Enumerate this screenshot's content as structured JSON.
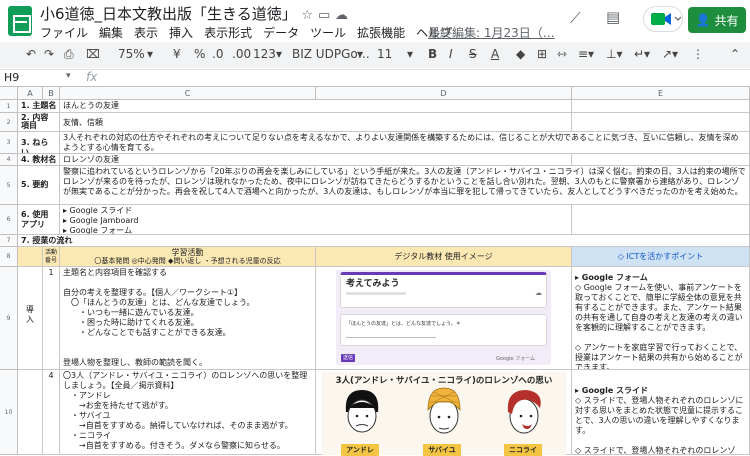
{
  "header": {
    "title": "小6道徳_日本文教出版「生きる道徳」",
    "menu": [
      "ファイル",
      "編集",
      "表示",
      "挿入",
      "表示形式",
      "データ",
      "ツール",
      "拡張機能",
      "ヘルプ"
    ],
    "last_edit": "最終編集: 1月23日（…",
    "share_label": "共有"
  },
  "toolbar": {
    "zoom": "75%",
    "currency": "¥",
    "percent": "%",
    "decimal_dec": ".0",
    "decimal_inc": ".00",
    "format": "123",
    "font": "BIZ UDPGo…",
    "font_size": "11",
    "bold": "B",
    "italic": "I",
    "strike": "S",
    "text_color": "A"
  },
  "formula_bar": {
    "cell_ref": "H9",
    "fx": "fx"
  },
  "columns": [
    "A",
    "B",
    "C",
    "D",
    "E"
  ],
  "rows": {
    "r1": {
      "num": "1",
      "label": "1. 主題名",
      "value": "ほんとうの友達"
    },
    "r2": {
      "num": "2",
      "label": "2. 内容\n項目",
      "value": "友情、信頼"
    },
    "r3": {
      "num": "3",
      "label": "3. ねらい",
      "value": "3人それぞれの対応の仕方やそれぞれの考えについて足りない点を考えるなかで、よりよい友達関係を構築するためには、信じることが大切であることに気づき、互いに信頼し、友情を深めようとする心情を育てる。"
    },
    "r4": {
      "num": "4",
      "label": "4. 教材名",
      "value": "ロレンゾの友達"
    },
    "r5": {
      "num": "5",
      "label": "5. 要約",
      "value": "警察に追われているというロレンゾから「20年ぶりの再会を楽しみにしている」という手紙が来た。3人の友達（アンドレ・サバイユ・ニコライ）は深く悩む。約束の日、3人は約束の場所でロレンゾが来るのを待ったが、ロレンゾは現れなかったため、夜中にロレンゾが訪ねてきたらどうするかということを話し合い別れた。翌朝、3人のもとに警察署から連絡があり、ロレンゾが無実であることが分かった。再会を祝して4人で酒場へと向かったが、3人の友達は、もしロレンゾが本当に罪を犯して帰ってきていたら、友人としてどうすべきだったのかを考え始めた。"
    },
    "r6": {
      "num": "6",
      "label": "6. 使用\nアプリ",
      "apps": [
        "▸ Google スライド",
        "▸ Google Jamboard",
        "▸ Google フォーム"
      ]
    },
    "r7": {
      "num": "7",
      "label": "7. 授業の流れ"
    },
    "r8": {
      "num": "8",
      "col_b": "活動\n番号",
      "col_c_title": "学習活動",
      "col_c_sub": "〇基本発問 ◎中心発問 ◆問い返し ・予想される児童の反応",
      "col_d": "デジタル教材 使用イメージ",
      "col_e": "◇ ICTを活かすポイント"
    },
    "r9": {
      "num": "9",
      "col_a": "導\n入",
      "col_b": "1",
      "lines": [
        "主題名と内容項目を確認する",
        "",
        "自分の考えを整理する。【個人／ワークシート①】",
        "　〇「ほんとうの友達」とは、どんな友達でしょう。",
        "　　・いつも一緒に遊んでいる友達。",
        "　　・困った時に助けてくれる友達。",
        "　　・どんなことでも話すことができる友達。",
        "",
        "",
        "登場人物を整理し、教師の範読を聞く。"
      ],
      "form_title": "考えてみよう",
      "form_q": "「ほんとうの友達」とは、どんな友達でしょう。＊",
      "form_btn": "送信",
      "form_footer": "Google フォーム",
      "ict": [
        "▸ Google フォーム",
        "◇ Google フォームを使い、事前アンケートを取っておくことで、簡単に学級全体の意見を共有することができます。また、アンケート結果の共有を通して自身の考えと友達の考えの違いを客観的に理解することができます。",
        "",
        "◇ アンケートを家庭学習で行っておくことで、授業はアンケート結果の共有から始めることができます。"
      ]
    },
    "r10": {
      "num": "10",
      "col_b": "4",
      "lines": [
        "〇3人（アンドレ・サバイユ・ニコライ）のロレンゾへの思いを整理しましょう。【全員／掲示資料】",
        "　・アンドレ",
        "　　→お金を持たせて逃がす。",
        "　・サバイユ",
        "　　→自首をすすめる。納得していなければ、そのまま逃がす。",
        "　・ニコライ",
        "　　→自首をすすめる。付きそう。ダメなら警察に知らせる。"
      ],
      "slide_title": "3人(アンドレ・サバイユ・ニコライ)のロレンゾへの思い",
      "names": [
        "アンドレ",
        "サバイユ",
        "ニコライ"
      ],
      "ict": [
        "▸ Google スライド",
        "◇ スライドで、登場人物それぞれのロレンゾに対する思いをまとめた状態で児童に提示することで、3人の思いの違いを理解しやすくなります。",
        "",
        "◇ スライドで、登場人物それぞれのロレンゾ"
      ]
    }
  },
  "colors": {
    "header_fill": "#fce8b2",
    "ict_fill": "#cfe2f3",
    "share_green": "#1e8e3e",
    "tag_yellow": "#f4c542"
  }
}
